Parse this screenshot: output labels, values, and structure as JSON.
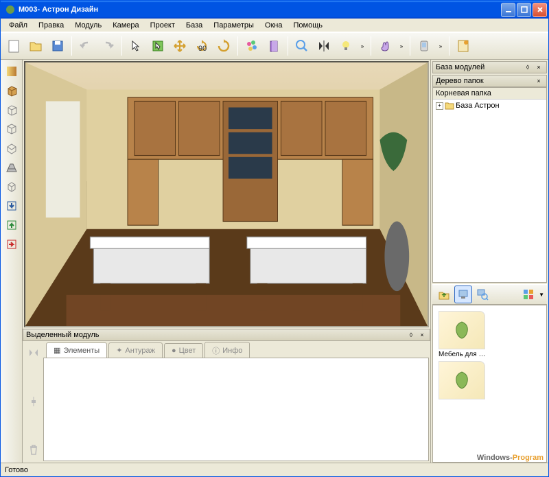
{
  "title": "М003- Астрон Дизайн",
  "menu": [
    "Файл",
    "Правка",
    "Модуль",
    "Камера",
    "Проект",
    "База",
    "Параметры",
    "Окна",
    "Помощь"
  ],
  "panels": {
    "module_base": "База модулей",
    "folder_tree": "Дерево папок",
    "root_folder": "Корневая папка",
    "tree_item": "База Астрон",
    "selected_module": "Выделенный модуль"
  },
  "tabs": [
    "Элементы",
    "Антураж",
    "Цвет",
    "Инфо"
  ],
  "thumbs": [
    "Мебель для д...",
    ""
  ],
  "status": "Готово",
  "watermark": {
    "a": "Windows-",
    "b": "Program"
  }
}
